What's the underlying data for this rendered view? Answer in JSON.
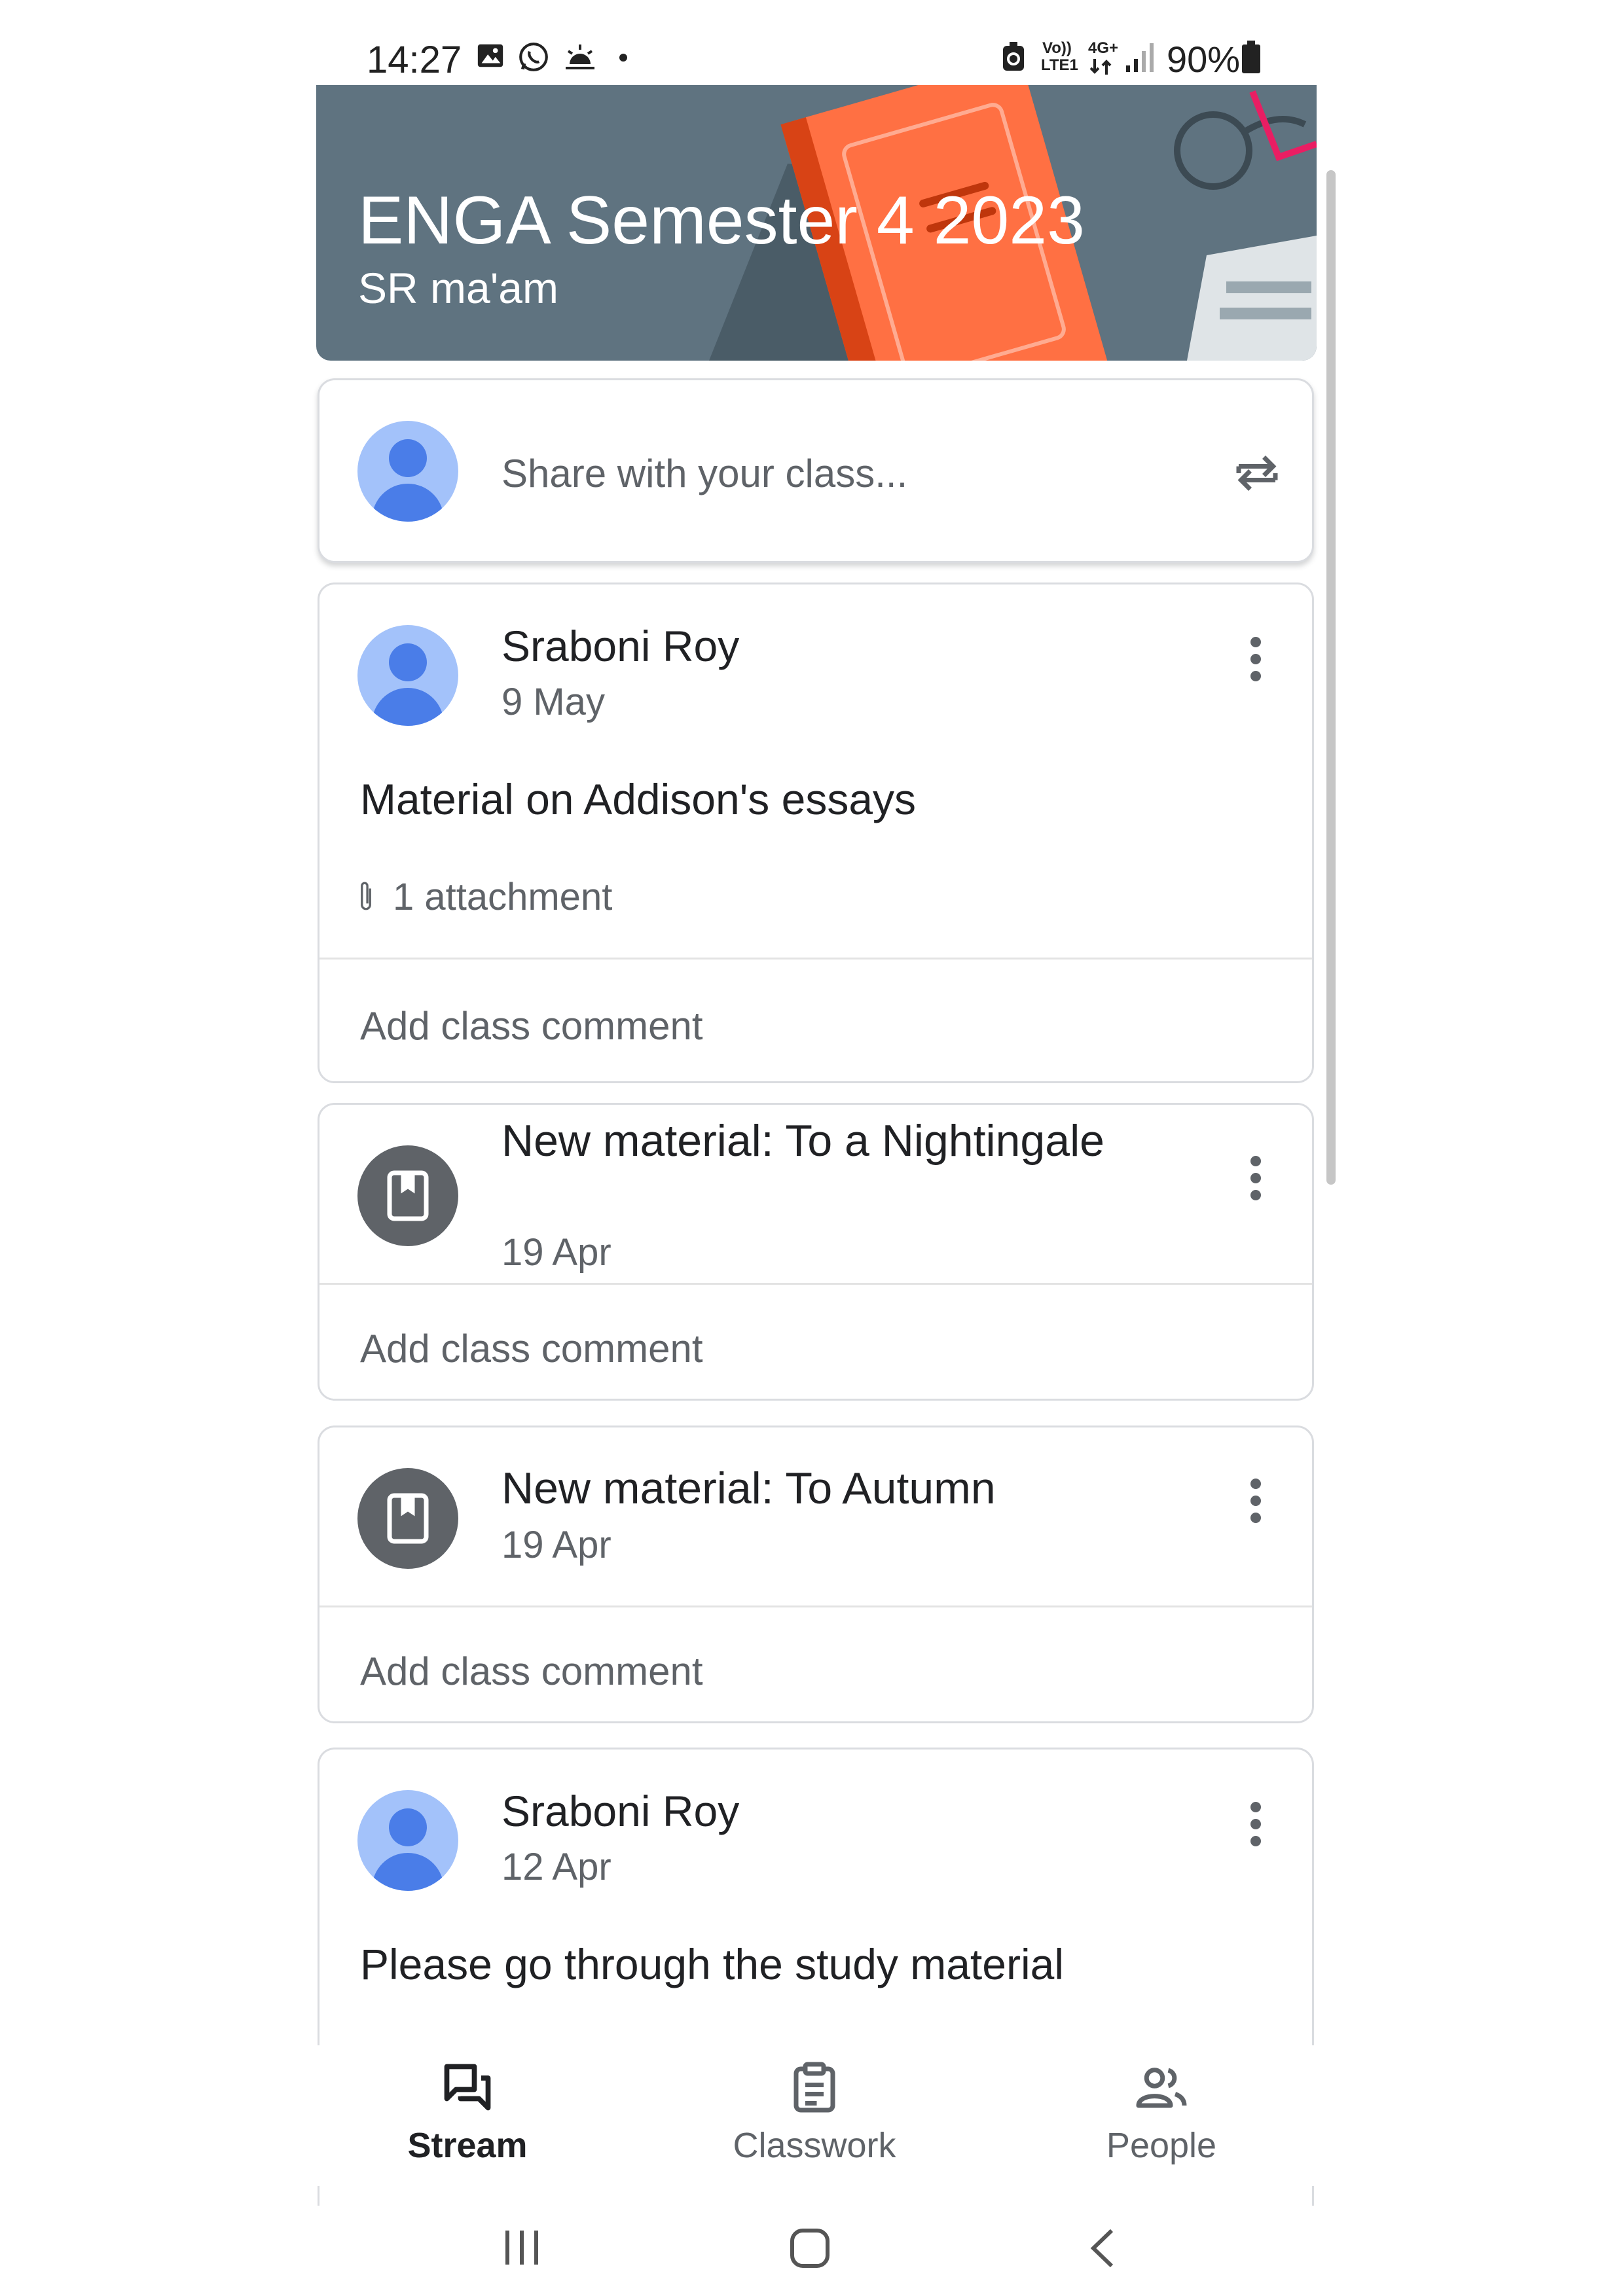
{
  "status_bar": {
    "time": "14:27",
    "network_labels": [
      "Vo))",
      "LTE1",
      "4G+"
    ],
    "battery": "90%"
  },
  "banner": {
    "title": "ENGA Semester 4 2023",
    "subtitle": "SR ma'am",
    "color": "#5f7380"
  },
  "share_box": {
    "placeholder": "Share with your class..."
  },
  "posts": [
    {
      "type": "announcement",
      "author": "Sraboni Roy",
      "date": "9 May",
      "text": "Material on Addison's essays",
      "attachments": "1 attachment",
      "comment_prompt": "Add class comment"
    },
    {
      "type": "material",
      "title": "New material: To a Nightingale",
      "date": "19 Apr",
      "comment_prompt": "Add class comment"
    },
    {
      "type": "material",
      "title": "New material: To Autumn",
      "date": "19 Apr",
      "comment_prompt": "Add class comment"
    },
    {
      "type": "announcement",
      "author": "Sraboni Roy",
      "date": "12 Apr",
      "text": "Please go through the study material"
    }
  ],
  "bottom_nav": [
    {
      "label": "Stream",
      "icon": "stream-icon",
      "active": true
    },
    {
      "label": "Classwork",
      "icon": "classwork-icon",
      "active": false
    },
    {
      "label": "People",
      "icon": "people-icon",
      "active": false
    }
  ],
  "colors": {
    "avatar_bg": "#a3c2fa",
    "avatar_fg": "#4a7de8",
    "material_icon_bg": "#5f6368",
    "banner_book": "#ff7043"
  }
}
